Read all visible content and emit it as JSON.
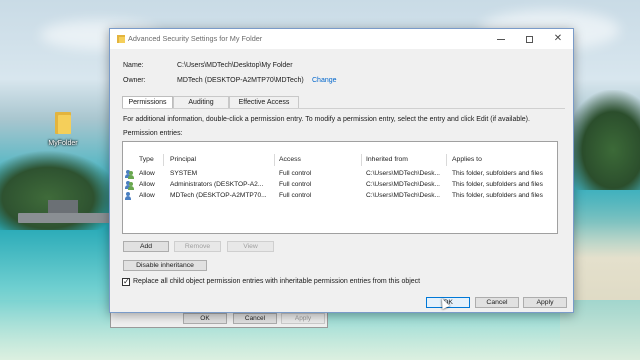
{
  "desktop": {
    "folder_icon_label": "MyFolder"
  },
  "behind_dialog": {
    "ok_label": "OK",
    "cancel_label": "Cancel",
    "apply_label": "Apply"
  },
  "dialog": {
    "title": "Advanced Security Settings for My Folder",
    "name_label": "Name:",
    "name_value": "C:\\Users\\MDTech\\Desktop\\My Folder",
    "owner_label": "Owner:",
    "owner_value": "MDTech (DESKTOP-A2MTP70\\MDTech)",
    "change_link": "Change",
    "tabs": [
      {
        "label": "Permissions",
        "active": true
      },
      {
        "label": "Auditing",
        "active": false
      },
      {
        "label": "Effective Access",
        "active": false
      }
    ],
    "info_text": "For additional information, double-click a permission entry. To modify a permission entry, select the entry and click Edit (if available).",
    "entries_label": "Permission entries:",
    "columns": [
      "Type",
      "Principal",
      "Access",
      "Inherited from",
      "Applies to"
    ],
    "entries": [
      {
        "type": "Allow",
        "principal": "SYSTEM",
        "access": "Full control",
        "inherited_from": "C:\\Users\\MDTech\\Desk...",
        "applies_to": "This folder, subfolders and files"
      },
      {
        "type": "Allow",
        "principal": "Administrators (DESKTOP-A2...",
        "access": "Full control",
        "inherited_from": "C:\\Users\\MDTech\\Desk...",
        "applies_to": "This folder, subfolders and files"
      },
      {
        "type": "Allow",
        "principal": "MDTech (DESKTOP-A2MTP70...",
        "access": "Full control",
        "inherited_from": "C:\\Users\\MDTech\\Desk...",
        "applies_to": "This folder, subfolders and files"
      }
    ],
    "add_label": "Add",
    "remove_label": "Remove",
    "view_label": "View",
    "disable_inheritance_label": "Disable inheritance",
    "replace_checkbox_label": "Replace all child object permission entries with inheritable permission entries from this object",
    "replace_checked": true,
    "ok_label": "OK",
    "cancel_label": "Cancel",
    "apply_label": "Apply"
  }
}
